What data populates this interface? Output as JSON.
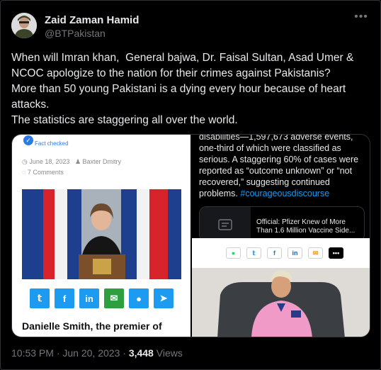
{
  "author": {
    "name": "Zaid Zaman Hamid",
    "handle": "@BTPakistan"
  },
  "tweet": {
    "text": "When will Imran khan,  General bajwa, Dr. Faisal Sultan, Asad Umer &\nNCOC apologize to the nation for their crimes against Pakistanis?\nMore than 50 young Pakistani is a dying every hour because of heart\nattacks.\nThe statistics are staggering all over the world."
  },
  "left_panel": {
    "fact_checked": "Fact checked",
    "date": "June 18, 2023",
    "author": "Baxter Dmitry",
    "comments": "7 Comments",
    "caption": "Danielle Smith, the premier of",
    "share_buttons": [
      "twitter-icon",
      "facebook-icon",
      "linkedin-icon",
      "email-icon",
      "reddit-icon",
      "telegram-icon"
    ]
  },
  "right_panel": {
    "text_top": "disabilities—1,597,673 adverse events, one-third of which were classified as serious. A staggering 60% of cases were reported as “outcome unknown” or “not recovered,” suggesting continued problems.",
    "hashtag": "#courageousdiscourse",
    "card_title": "Official: Pfizer Knew of More Than 1.6 Million Vaccine Side...",
    "share_icons": [
      "whatsapp-icon",
      "twitter-icon",
      "facebook-icon",
      "linkedin-icon",
      "email-icon",
      "more-icon"
    ]
  },
  "footer": {
    "time": "10:53 PM",
    "separator": "·",
    "date": "Jun 20, 2023",
    "views_count": "3,448",
    "views_label": "Views"
  },
  "colors": {
    "background": "#000000",
    "text_primary": "#e7e9ea",
    "text_secondary": "#71767b",
    "link": "#1d9bf0",
    "share_blue": "#1d9bf0",
    "share_green": "#2e9e3e",
    "share_orange": "#ff4500"
  }
}
